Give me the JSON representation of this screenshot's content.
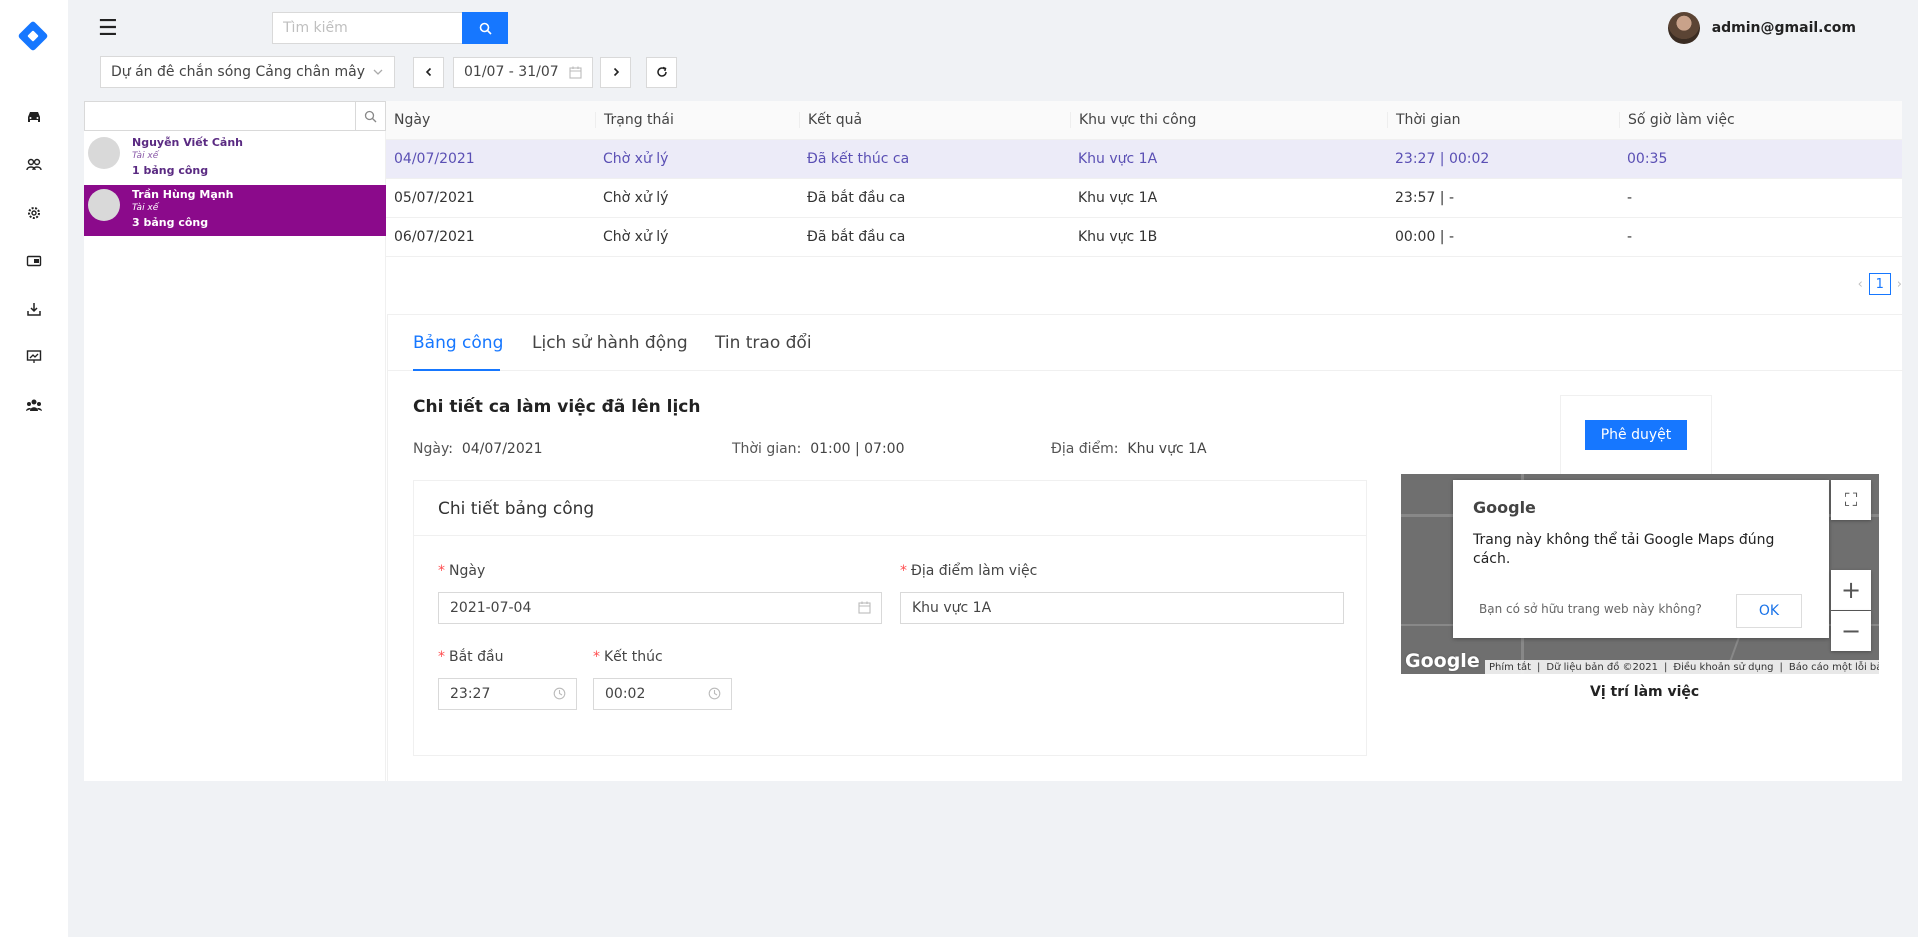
{
  "app": {
    "brand_icon": "diamond-logo-icon",
    "accent": "#1677ff",
    "highlight": "#8b0a8b"
  },
  "sidebar": {
    "items": [
      {
        "icon": "car-icon"
      },
      {
        "icon": "users-icon"
      },
      {
        "icon": "gear-icon"
      },
      {
        "icon": "vehicle-card-icon"
      },
      {
        "icon": "download-icon"
      },
      {
        "icon": "presentation-icon"
      },
      {
        "icon": "team-icon"
      }
    ]
  },
  "header": {
    "search_placeholder": "Tìm kiếm",
    "user_email": "admin@gmail.com"
  },
  "filters": {
    "project": "Dự án đê chắn sóng Cảng chân mây",
    "date_range": "01/07 - 31/07"
  },
  "employees": [
    {
      "name": "Nguyễn Viết Cảnh",
      "role": "Tài xế",
      "count": "1 bảng công",
      "active": false
    },
    {
      "name": "Trần Hùng Mạnh",
      "role": "Tài xế",
      "count": "3 bảng công",
      "active": true
    }
  ],
  "table": {
    "columns": [
      "Ngày",
      "Trạng thái",
      "Kết quả",
      "Khu vực thi công",
      "Thời gian",
      "Số giờ làm việc"
    ],
    "rows": [
      [
        "04/07/2021",
        "Chờ xử lý",
        "Đã kết thúc ca",
        "Khu vực 1A",
        "23:27 | 00:02",
        "00:35"
      ],
      [
        "05/07/2021",
        "Chờ xử lý",
        "Đã bắt đầu ca",
        "Khu vực 1A",
        "23:57 | -",
        "-"
      ],
      [
        "06/07/2021",
        "Chờ xử lý",
        "Đã bắt đầu ca",
        "Khu vực 1B",
        "00:00 | -",
        "-"
      ]
    ],
    "page": "1"
  },
  "tabs": [
    "Bảng công",
    "Lịch sử hành động",
    "Tin trao đổi"
  ],
  "detail": {
    "title": "Chi tiết ca làm việc đã lên lịch",
    "date_label": "Ngày",
    "date_value": "04/07/2021",
    "time_label": "Thời gian",
    "time_value": "01:00 | 07:00",
    "place_label": "Địa điểm",
    "place_value": "Khu vực 1A",
    "approve": "Phê duyệt"
  },
  "form": {
    "title": "Chi tiết bảng công",
    "date_label": "Ngày",
    "date_value": "2021-07-04",
    "location_label": "Địa điểm làm việc",
    "location_value": "Khu vực 1A",
    "start_label": "Bắt đầu",
    "start_value": "23:27",
    "end_label": "Kết thúc",
    "end_value": "00:02"
  },
  "map": {
    "brand": "Google",
    "message": "Trang này không thể tải Google Maps đúng cách.",
    "owner_q": "Bạn có sở hữu trang web này không?",
    "ok": "OK",
    "footer": [
      "Phím tắt",
      "Dữ liệu bản đồ ©2021",
      "Điều khoản sử dụng",
      "Báo cáo một lỗi bản đồ"
    ],
    "watermark": "Google",
    "caption": "Vị trí làm việc"
  }
}
